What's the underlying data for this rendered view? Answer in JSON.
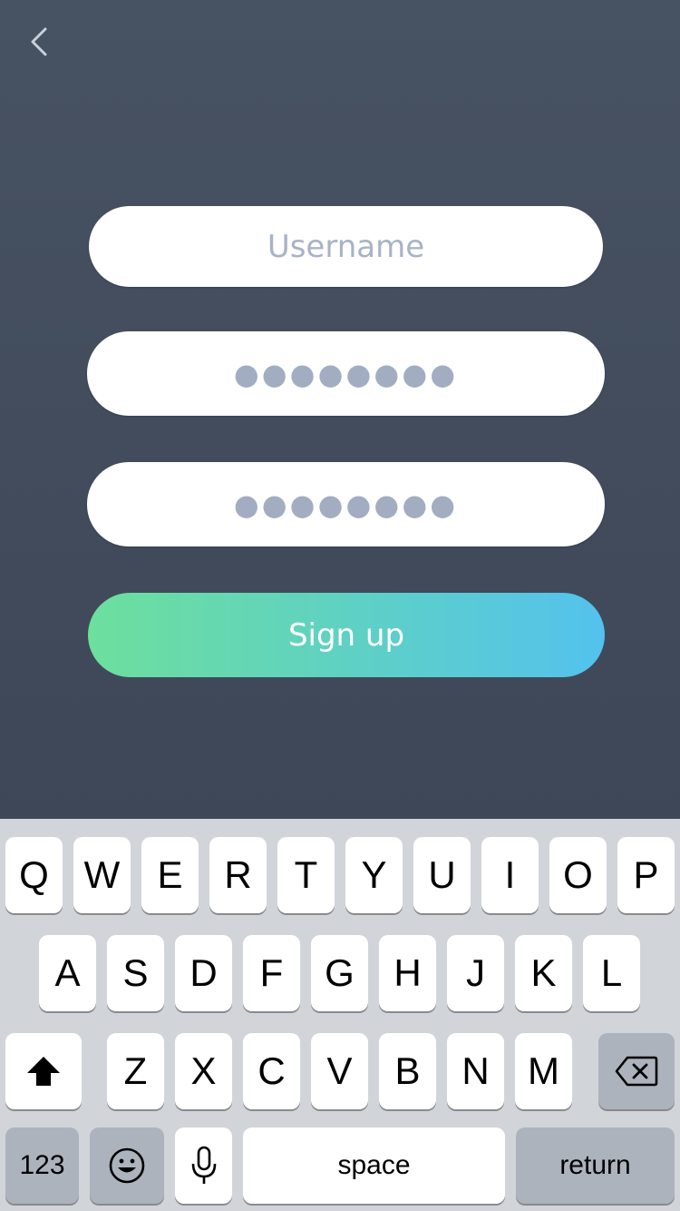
{
  "back": {
    "icon": "chevron-left-icon"
  },
  "form": {
    "username_placeholder": "Username",
    "password_mask": "●●●●●●●●",
    "confirm_mask": "●●●●●●●●",
    "signup_label": "Sign up"
  },
  "keyboard": {
    "row1": [
      "Q",
      "W",
      "E",
      "R",
      "T",
      "Y",
      "U",
      "I",
      "O",
      "P"
    ],
    "row2": [
      "A",
      "S",
      "D",
      "F",
      "G",
      "H",
      "J",
      "K",
      "L"
    ],
    "row3": [
      "Z",
      "X",
      "C",
      "V",
      "B",
      "N",
      "M"
    ],
    "numbers_label": "123",
    "space_label": "space",
    "return_label": "return",
    "icons": {
      "shift": "shift-icon",
      "delete": "backspace-icon",
      "emoji": "emoji-icon",
      "dictation": "microphone-icon"
    }
  },
  "colors": {
    "background_top": "#475262",
    "background_bottom": "#3e4757",
    "placeholder": "#a9b3c6",
    "signup_gradient_start": "#6ddf9d",
    "signup_gradient_end": "#53c2ee",
    "keyboard_bg": "#d1d4d9",
    "key_dark": "#acb3bd"
  }
}
